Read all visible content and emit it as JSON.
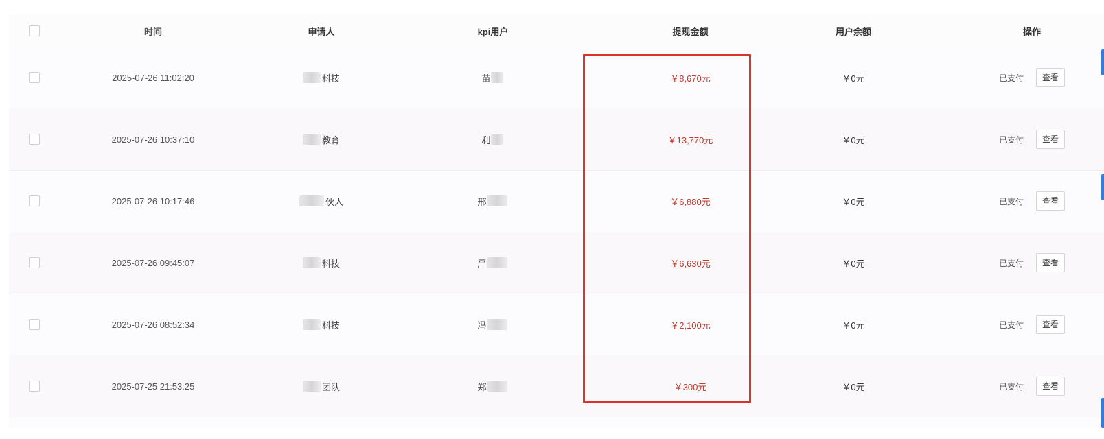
{
  "table": {
    "headers": {
      "time": "时间",
      "applicant": "申请人",
      "kpi_user": "kpi用户",
      "withdraw_amount": "提现金额",
      "user_balance": "用户余额",
      "actions": "操作"
    },
    "rows": [
      {
        "time": "2025-07-26 11:02:20",
        "applicant_suffix": "科技",
        "kpi_prefix": "苗",
        "amount": "￥8,670元",
        "balance": "￥0元",
        "status": "已支付",
        "view_label": "查看"
      },
      {
        "time": "2025-07-26 10:37:10",
        "applicant_suffix": "教育",
        "kpi_prefix": "利",
        "amount": "￥13,770元",
        "balance": "￥0元",
        "status": "已支付",
        "view_label": "查看"
      },
      {
        "time": "2025-07-26 10:17:46",
        "applicant_suffix": "伙人",
        "kpi_prefix": "邢",
        "amount": "￥6,880元",
        "balance": "￥0元",
        "status": "已支付",
        "view_label": "查看"
      },
      {
        "time": "2025-07-26 09:45:07",
        "applicant_suffix": "科技",
        "kpi_prefix": "严",
        "amount": "￥6,630元",
        "balance": "￥0元",
        "status": "已支付",
        "view_label": "查看"
      },
      {
        "time": "2025-07-26 08:52:34",
        "applicant_suffix": "科技",
        "kpi_prefix": "冯",
        "amount": "￥2,100元",
        "balance": "￥0元",
        "status": "已支付",
        "view_label": "查看"
      },
      {
        "time": "2025-07-25 21:53:25",
        "applicant_suffix": "团队",
        "kpi_prefix": "郑",
        "amount": "￥300元",
        "balance": "￥0元",
        "status": "已支付",
        "view_label": "查看"
      }
    ]
  },
  "colors": {
    "amount_text": "#c0392b",
    "highlight_border": "#d8342b",
    "edge_tab": "#2f7de1"
  }
}
